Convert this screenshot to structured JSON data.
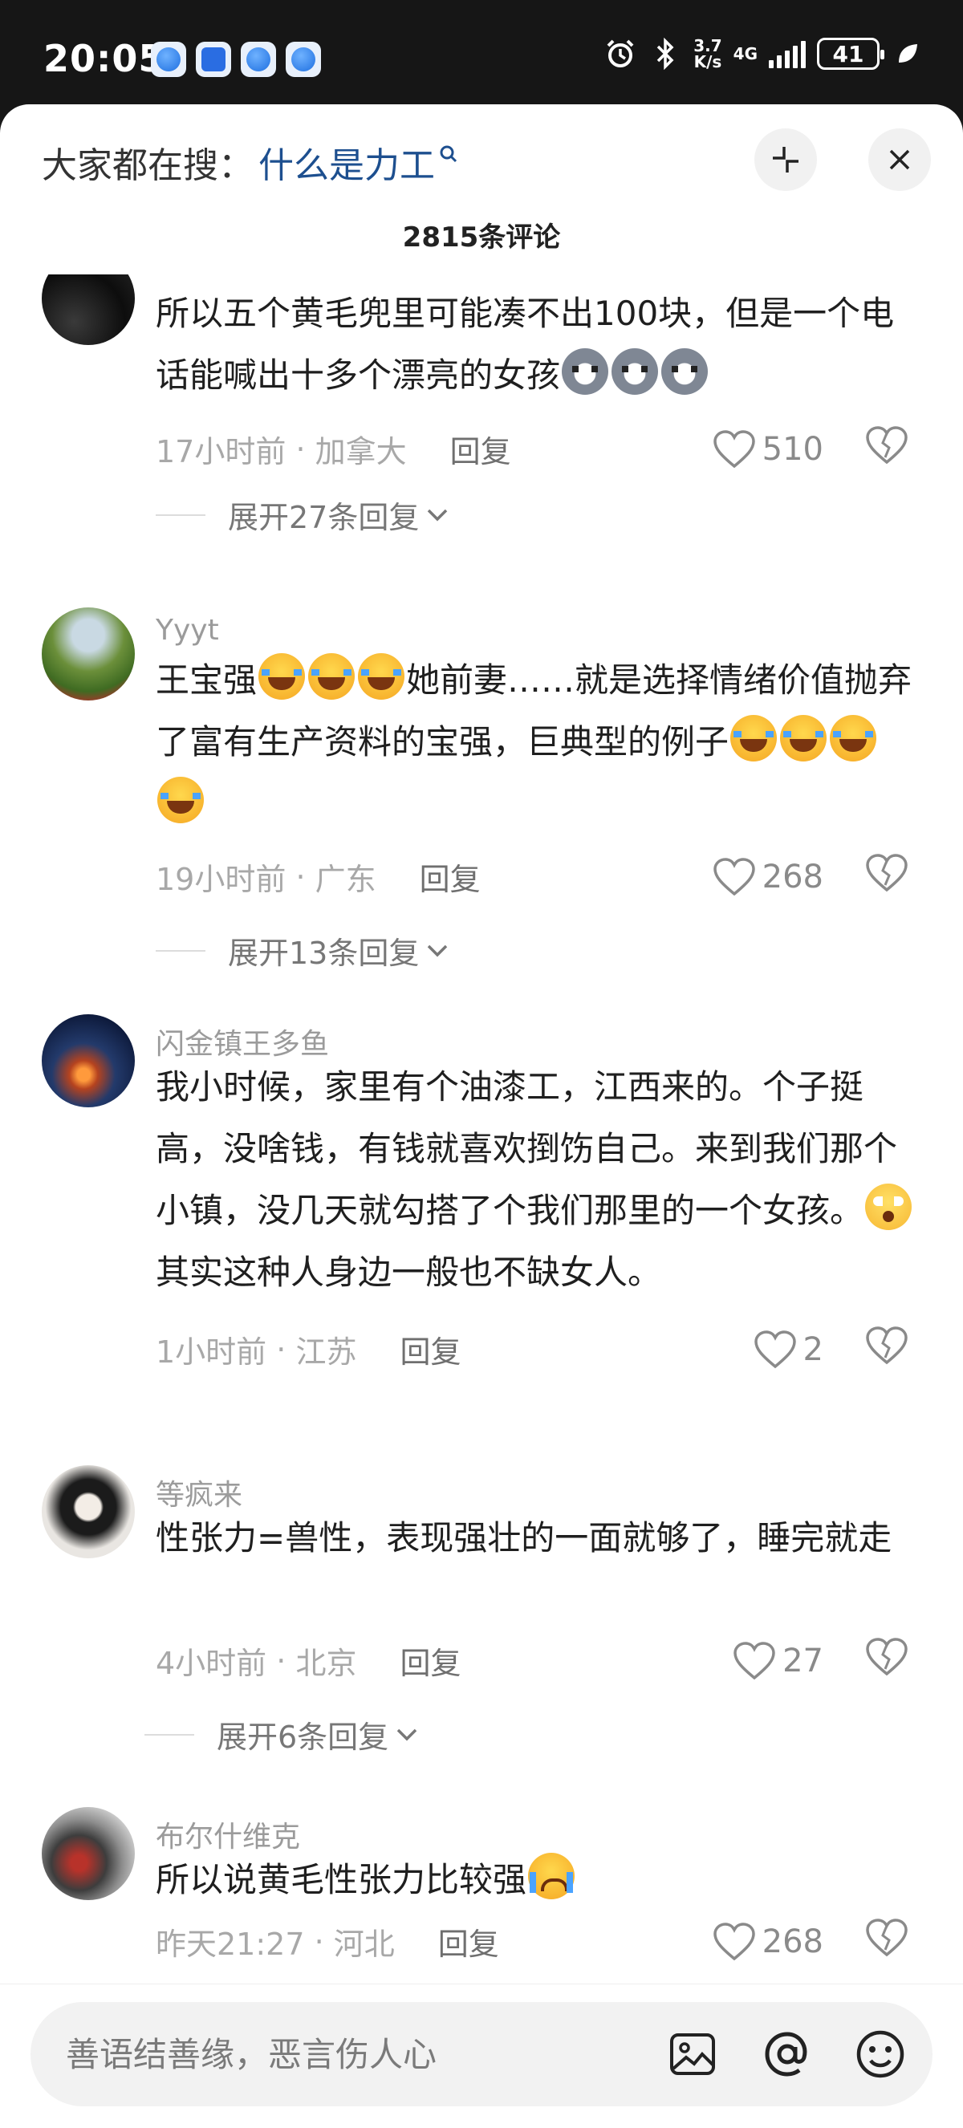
{
  "status_bar": {
    "time": "20:05",
    "net_speed_top": "3.7",
    "net_speed_bottom": "K/s",
    "network": "4G",
    "battery": "41"
  },
  "header": {
    "search_prefix": "大家都在搜：",
    "search_query": "什么是力工",
    "comment_count": "2815条评论"
  },
  "comments": [
    {
      "username": "",
      "text_parts": [
        "所以五个黄毛兜里可能凑不出100块，但是一个电话能喊出十多个漂亮的女孩"
      ],
      "time": "17小时前",
      "location": "加拿大",
      "reply_label": "回复",
      "likes": "510",
      "expand_label": "展开27条回复"
    },
    {
      "username": "Yyyt",
      "text_a": "王宝强",
      "text_b": "她前妻……就是选择情绪价值抛弃了富有生产资料的宝强，巨典型的例子",
      "time": "19小时前",
      "location": "广东",
      "reply_label": "回复",
      "likes": "268",
      "expand_label": "展开13条回复"
    },
    {
      "username": "闪金镇王多鱼",
      "text_a": "我小时候，家里有个油漆工，江西来的。个子挺高，没啥钱，有钱就喜欢捯饬自己。来到我们那个小镇，没几天就勾搭了个我们那里的一个女孩。",
      "text_b": "其实这种人身边一般也不缺女人。",
      "time": "1小时前",
      "location": "江苏",
      "reply_label": "回复",
      "likes": "2"
    },
    {
      "username": "等疯来",
      "text_a": "性张力=兽性，表现强壮的一面就够了，睡完就走",
      "time": "4小时前",
      "location": "北京",
      "reply_label": "回复",
      "likes": "27",
      "expand_label": "展开6条回复"
    },
    {
      "username": "布尔什维克",
      "text_a": "所以说黄毛性张力比较强",
      "time": "昨天21:27",
      "location": "河北",
      "reply_label": "回复",
      "likes": "268"
    }
  ],
  "input_bar": {
    "placeholder": "善语结善缘，恶言伤人心"
  },
  "icons": {
    "status": [
      "alarm-icon",
      "bluetooth-icon",
      "signal-icon",
      "battery-icon",
      "leaf-icon"
    ],
    "header": [
      "search-icon",
      "collapse-icon",
      "close-icon"
    ],
    "comment": [
      "heart-icon",
      "dislike-heart-icon",
      "chevron-down-icon"
    ],
    "input": [
      "image-icon",
      "at-icon",
      "emoji-icon"
    ]
  }
}
